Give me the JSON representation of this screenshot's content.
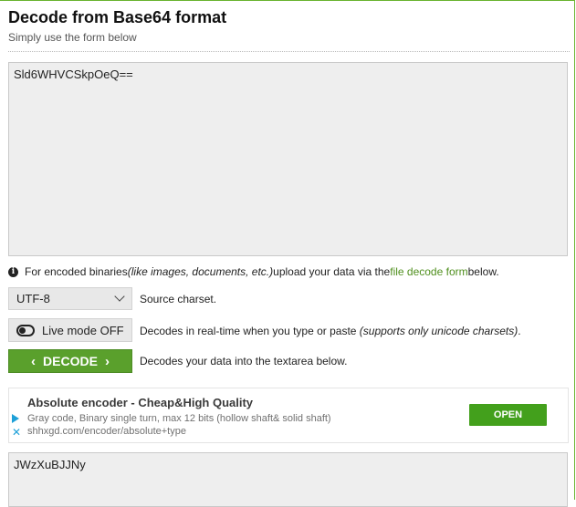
{
  "header": {
    "title": "Decode from Base64 format",
    "subtitle": "Simply use the form below"
  },
  "input": {
    "value": "Sld6WHVCSkpOeQ=="
  },
  "info": {
    "text_before": "For encoded binaries ",
    "text_italic": "(like images, documents, etc.)",
    "text_middle": " upload your data via the ",
    "link": "file decode form",
    "text_after": " below."
  },
  "charset": {
    "selected": "UTF-8",
    "label": "Source charset."
  },
  "live_mode": {
    "button_label": "Live mode OFF",
    "desc_before": "Decodes in real-time when you type or paste ",
    "desc_italic": "(supports only unicode charsets)",
    "desc_after": "."
  },
  "decode": {
    "button_label": "DECODE",
    "desc": "Decodes your data into the textarea below."
  },
  "ad": {
    "title": "Absolute encoder - Cheap&High Quality",
    "description": "Gray code, Binary single turn, max 12 bits (hollow shaft& solid shaft)",
    "url": "shhxgd.com/encoder/absolute+type",
    "open_label": "OPEN",
    "close_glyph": "✕"
  },
  "output": {
    "value": "JWzXuBJJNy"
  },
  "colors": {
    "accent": "#5aa02c",
    "link": "#4f8f1d",
    "ad_open": "#43a01c",
    "ad_icon": "#1ea0d8"
  },
  "icons": [
    "info-icon",
    "toggle-icon",
    "chevron-down-icon",
    "chevron-left-icon",
    "chevron-right-icon",
    "ad-choices-icon",
    "ad-close-icon"
  ]
}
